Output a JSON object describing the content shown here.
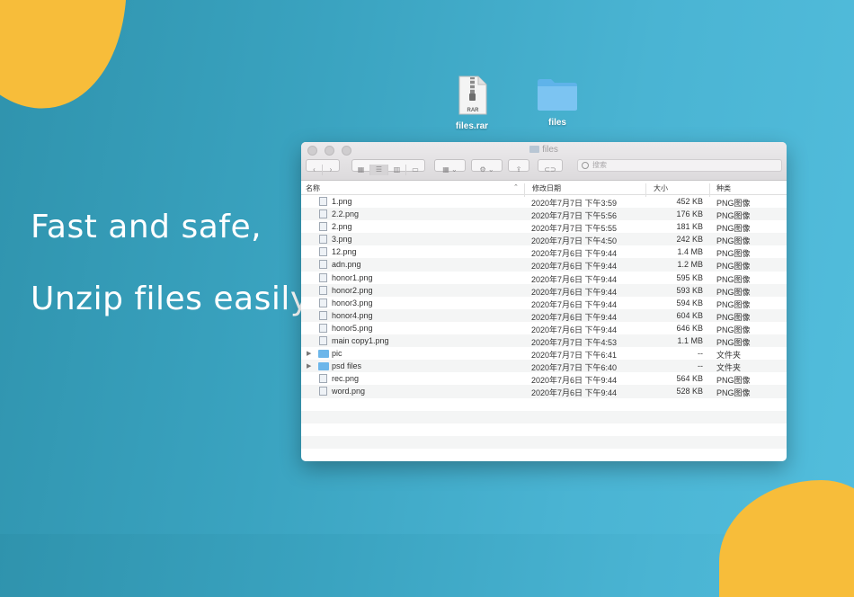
{
  "hero": {
    "line1": "Fast and safe,",
    "line2": "Unzip files easily"
  },
  "desktop": {
    "rar_icon_text": "RAR",
    "rar_label": "files.rar",
    "folder_label": "files"
  },
  "window": {
    "title": "files",
    "search_placeholder": "搜索",
    "columns": {
      "name": "名称",
      "date": "修改日期",
      "size": "大小",
      "kind": "种类"
    }
  },
  "files": [
    {
      "name": "1.png",
      "date": "2020年7月7日 下午3:59",
      "size": "452 KB",
      "kind": "PNG图像",
      "type": "file"
    },
    {
      "name": "2.2.png",
      "date": "2020年7月7日 下午5:56",
      "size": "176 KB",
      "kind": "PNG图像",
      "type": "file"
    },
    {
      "name": "2.png",
      "date": "2020年7月7日 下午5:55",
      "size": "181 KB",
      "kind": "PNG图像",
      "type": "file"
    },
    {
      "name": "3.png",
      "date": "2020年7月7日 下午4:50",
      "size": "242 KB",
      "kind": "PNG图像",
      "type": "file"
    },
    {
      "name": "12.png",
      "date": "2020年7月6日 下午9:44",
      "size": "1.4 MB",
      "kind": "PNG图像",
      "type": "file"
    },
    {
      "name": "adn.png",
      "date": "2020年7月6日 下午9:44",
      "size": "1.2 MB",
      "kind": "PNG图像",
      "type": "file"
    },
    {
      "name": "honor1.png",
      "date": "2020年7月6日 下午9:44",
      "size": "595 KB",
      "kind": "PNG图像",
      "type": "file"
    },
    {
      "name": "honor2.png",
      "date": "2020年7月6日 下午9:44",
      "size": "593 KB",
      "kind": "PNG图像",
      "type": "file"
    },
    {
      "name": "honor3.png",
      "date": "2020年7月6日 下午9:44",
      "size": "594 KB",
      "kind": "PNG图像",
      "type": "file"
    },
    {
      "name": "honor4.png",
      "date": "2020年7月6日 下午9:44",
      "size": "604 KB",
      "kind": "PNG图像",
      "type": "file"
    },
    {
      "name": "honor5.png",
      "date": "2020年7月6日 下午9:44",
      "size": "646 KB",
      "kind": "PNG图像",
      "type": "file"
    },
    {
      "name": "main copy1.png",
      "date": "2020年7月7日 下午4:53",
      "size": "1.1 MB",
      "kind": "PNG图像",
      "type": "file"
    },
    {
      "name": "pic",
      "date": "2020年7月7日 下午6:41",
      "size": "--",
      "kind": "文件夹",
      "type": "folder"
    },
    {
      "name": "psd files",
      "date": "2020年7月7日 下午6:40",
      "size": "--",
      "kind": "文件夹",
      "type": "folder"
    },
    {
      "name": "rec.png",
      "date": "2020年7月6日 下午9:44",
      "size": "564 KB",
      "kind": "PNG图像",
      "type": "file"
    },
    {
      "name": "word.png",
      "date": "2020年7月6日 下午9:44",
      "size": "528 KB",
      "kind": "PNG图像",
      "type": "file"
    }
  ],
  "colors": {
    "accent_yellow": "#f7bd3a",
    "background_teal": "#3aa3c0",
    "folder_blue": "#6cb6ea"
  }
}
